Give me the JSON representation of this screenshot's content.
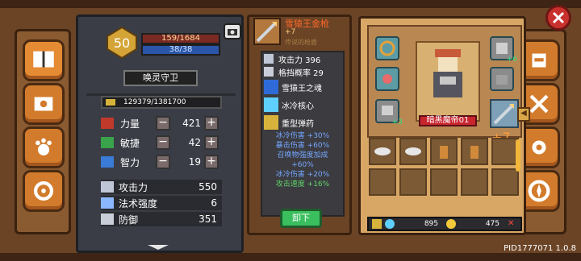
{
  "stats_panel": {
    "level": "50",
    "xp": "159/1684",
    "mana": "38/38",
    "character_name": "唤灵守卫",
    "gold": "129379/1381700",
    "attributes": [
      {
        "label": "力量",
        "value": "421"
      },
      {
        "label": "敏捷",
        "value": "42"
      },
      {
        "label": "智力",
        "value": "19"
      }
    ],
    "derived": [
      {
        "label": "攻击力",
        "value": "550"
      },
      {
        "label": "法术强度",
        "value": "6"
      },
      {
        "label": "防御",
        "value": "351"
      }
    ]
  },
  "item_panel": {
    "title": "雪猿王金枪",
    "enhance": "+7",
    "rarity": "传说的枪盾",
    "attack": "攻击力 396",
    "block": "格挡概率 29",
    "skills": [
      {
        "name": "雪猿王之魂"
      },
      {
        "name": "冰冷核心"
      },
      {
        "name": "重型弹药"
      }
    ],
    "bonuses": [
      {
        "text": "冰冷伤害 +30%",
        "color": "blue"
      },
      {
        "text": "暴击伤害 +60%",
        "color": "blue"
      },
      {
        "text": "召唤物强度加成",
        "color": "blue"
      },
      {
        "text": "+60%",
        "color": "blue"
      },
      {
        "text": "冰冷伤害 +20%",
        "color": "blue"
      },
      {
        "text": "攻击速度 +16%",
        "color": "green"
      }
    ],
    "unequip": "卸下"
  },
  "equip_panel": {
    "hero_name": "暗黑魔帝01",
    "slot_plus": [
      "+6",
      "+3",
      "+7"
    ],
    "resources": [
      {
        "value": "895"
      },
      {
        "value": "475"
      }
    ]
  },
  "version": "PID1777071 1.0.8"
}
